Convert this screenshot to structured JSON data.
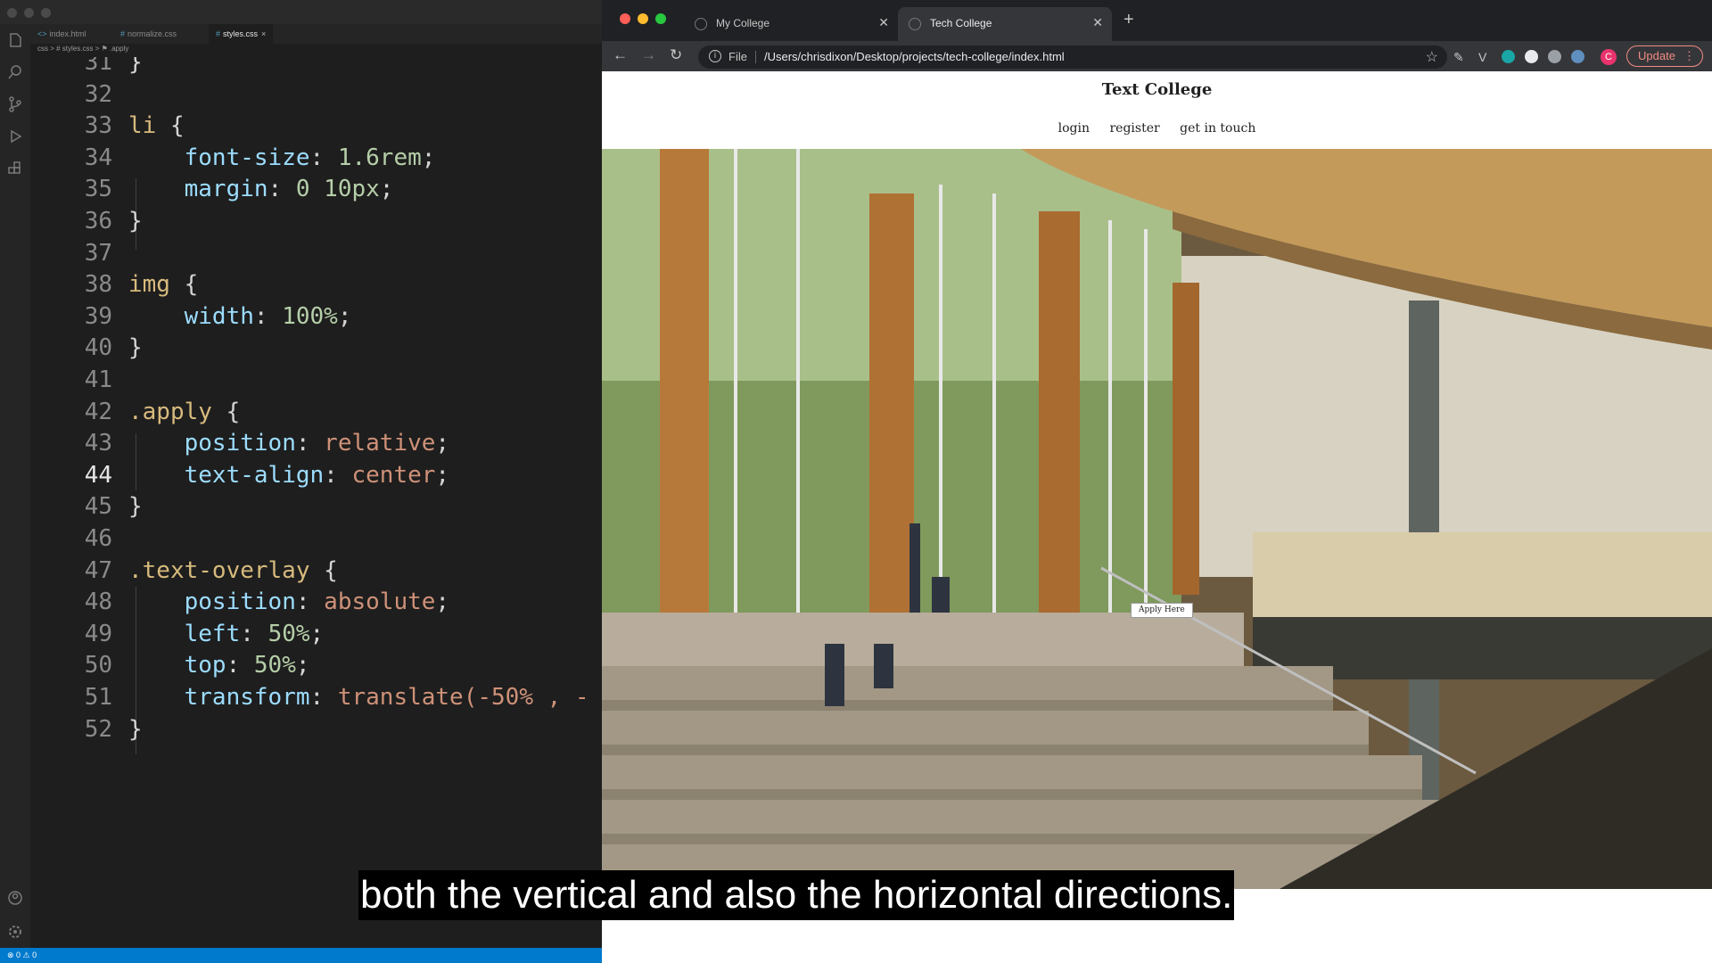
{
  "vscode": {
    "tabs": [
      {
        "label": "index.html",
        "icon": "html-file-icon"
      },
      {
        "label": "normalize.css",
        "icon": "css-file-icon"
      },
      {
        "label": "styles.css",
        "icon": "css-file-icon",
        "active": true
      }
    ],
    "breadcrumb": "css > # styles.css > ⚑ .apply",
    "status_text": "⊗ 0 ⚠ 0",
    "current_line": "44",
    "lines": [
      {
        "n": "31",
        "text": "}"
      },
      {
        "n": "32",
        "text": ""
      },
      {
        "n": "33",
        "text": "li {"
      },
      {
        "n": "34",
        "text": "    font-size: 1.6rem;"
      },
      {
        "n": "35",
        "text": "    margin: 0 10px;"
      },
      {
        "n": "36",
        "text": "}"
      },
      {
        "n": "37",
        "text": ""
      },
      {
        "n": "38",
        "text": "img {"
      },
      {
        "n": "39",
        "text": "    width: 100%;"
      },
      {
        "n": "40",
        "text": "}"
      },
      {
        "n": "41",
        "text": ""
      },
      {
        "n": "42",
        "text": ".apply {"
      },
      {
        "n": "43",
        "text": "    position: relative;"
      },
      {
        "n": "44",
        "text": "    text-align: center;"
      },
      {
        "n": "45",
        "text": "}"
      },
      {
        "n": "46",
        "text": ""
      },
      {
        "n": "47",
        "text": ".text-overlay {"
      },
      {
        "n": "48",
        "text": "    position: absolute;"
      },
      {
        "n": "49",
        "text": "    left: 50%;"
      },
      {
        "n": "50",
        "text": "    top: 50%;"
      },
      {
        "n": "51",
        "text": "    transform: translate(-50% , -"
      },
      {
        "n": "52",
        "text": "}"
      }
    ]
  },
  "browser": {
    "tabs": [
      {
        "title": "My College",
        "active": false
      },
      {
        "title": "Tech College",
        "active": true
      }
    ],
    "address_scheme": "File",
    "address_url": "/Users/chrisdixon/Desktop/projects/tech-college/index.html",
    "profile_initial": "C",
    "update_label": "Update",
    "page": {
      "site_title": "Text College",
      "nav": [
        "login",
        "register",
        "get in touch"
      ],
      "apply_button": "Apply Here"
    }
  },
  "caption": "both the vertical and also the horizontal directions.",
  "colors": {
    "editor_bg": "#1e1e1e",
    "selector": "#d7ba7d",
    "property": "#9cdcfe",
    "value": "#ce9178",
    "number": "#b5cea8",
    "status_bar": "#007acc",
    "update_accent": "#f28b82"
  }
}
